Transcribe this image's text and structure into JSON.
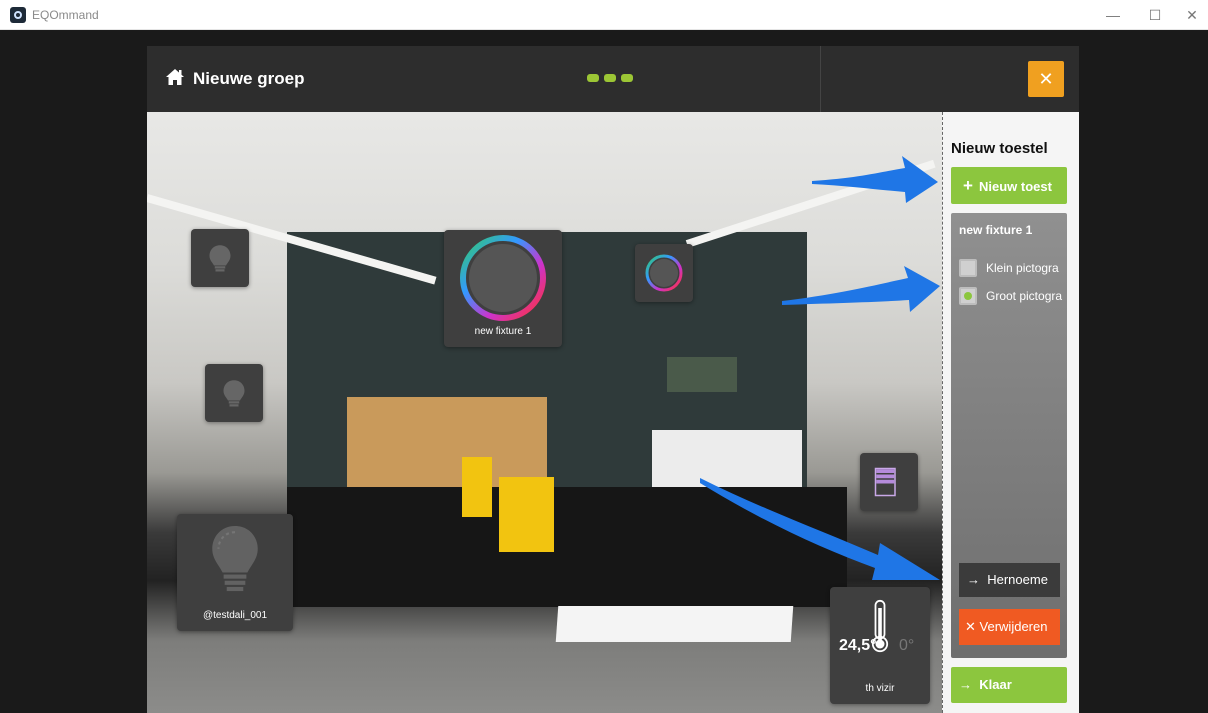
{
  "window": {
    "title": "EQOmmand",
    "minimize": "—",
    "maximize": "☐",
    "close": "✕"
  },
  "header": {
    "group_name": "Nieuwe groep",
    "close_symbol": "✕"
  },
  "tiles": {
    "rgb_large": {
      "label": "new fixture 1"
    },
    "bulb_large": {
      "label": "@testdali_001"
    },
    "thermostat": {
      "label": "th vizir",
      "current_temp": "24,5°",
      "set_temp": "0°"
    }
  },
  "panel": {
    "heading": "Nieuw toestel",
    "new_device_button": "Nieuw toest",
    "fixture_name": "new fixture 1",
    "options": [
      {
        "label": "Klein pictogra",
        "checked": false
      },
      {
        "label": "Groot pictogra",
        "checked": true
      }
    ],
    "rename_button": "Hernoeme",
    "delete_button": "Verwijderen",
    "done_button": "Klaar"
  },
  "colors": {
    "accent_green": "#8cc63e",
    "close_orange": "#f0a020",
    "delete_red": "#f05a22",
    "arrow_blue": "#1f76e6"
  }
}
